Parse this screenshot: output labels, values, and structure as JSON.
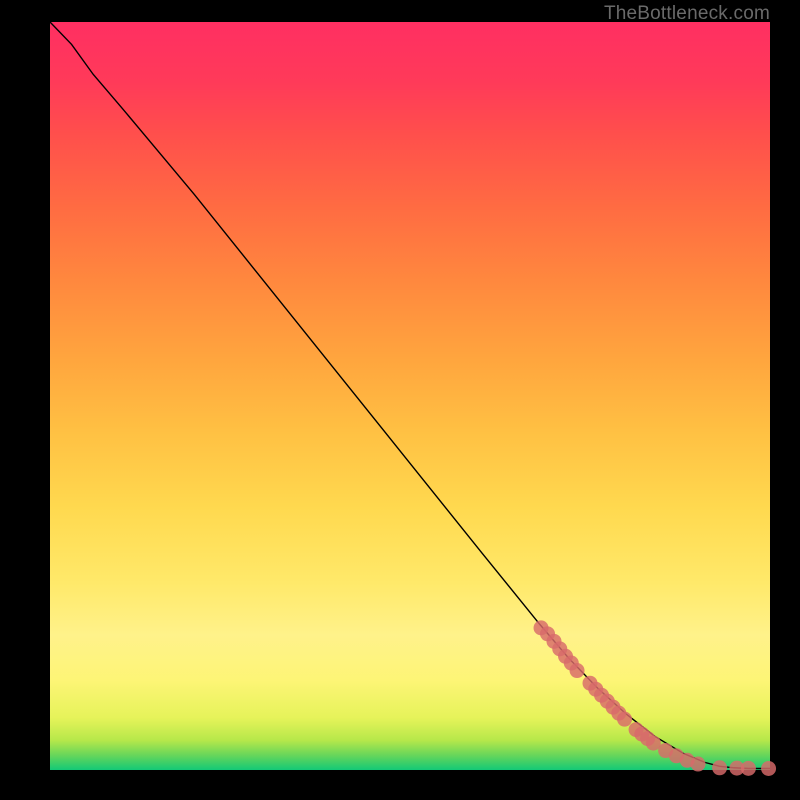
{
  "attribution": "TheBottleneck.com",
  "chart_data": {
    "type": "line",
    "title": "",
    "xlabel": "",
    "ylabel": "",
    "xlim": [
      0,
      100
    ],
    "ylim": [
      0,
      100
    ],
    "grid": false,
    "legend": false,
    "series": [
      {
        "name": "curve",
        "style": "line",
        "color": "#000000",
        "x": [
          0,
          3,
          6,
          10,
          20,
          30,
          40,
          50,
          60,
          68,
          72,
          76,
          80,
          84,
          88,
          91,
          93,
          95,
          97,
          98,
          100
        ],
        "y": [
          100,
          97,
          93,
          88.5,
          77,
          65,
          53,
          41,
          29,
          19.5,
          15,
          11,
          7.5,
          4.5,
          2.2,
          1.0,
          0.5,
          0.3,
          0.2,
          0.2,
          0.2
        ]
      },
      {
        "name": "markers",
        "style": "scatter",
        "color": "#d86a6a",
        "x": [
          68.2,
          69.1,
          70.0,
          70.8,
          71.6,
          72.4,
          73.2,
          75.0,
          75.8,
          76.6,
          77.4,
          78.2,
          79.0,
          79.8,
          81.4,
          82.2,
          83.0,
          83.8,
          85.5,
          87.0,
          88.5,
          90.0,
          93.0,
          95.4,
          97.0,
          99.8
        ],
        "y": [
          19.0,
          18.2,
          17.2,
          16.2,
          15.2,
          14.3,
          13.3,
          11.6,
          10.8,
          10.0,
          9.2,
          8.4,
          7.6,
          6.8,
          5.4,
          4.8,
          4.2,
          3.6,
          2.6,
          1.9,
          1.3,
          0.8,
          0.3,
          0.25,
          0.22,
          0.2
        ]
      }
    ]
  }
}
